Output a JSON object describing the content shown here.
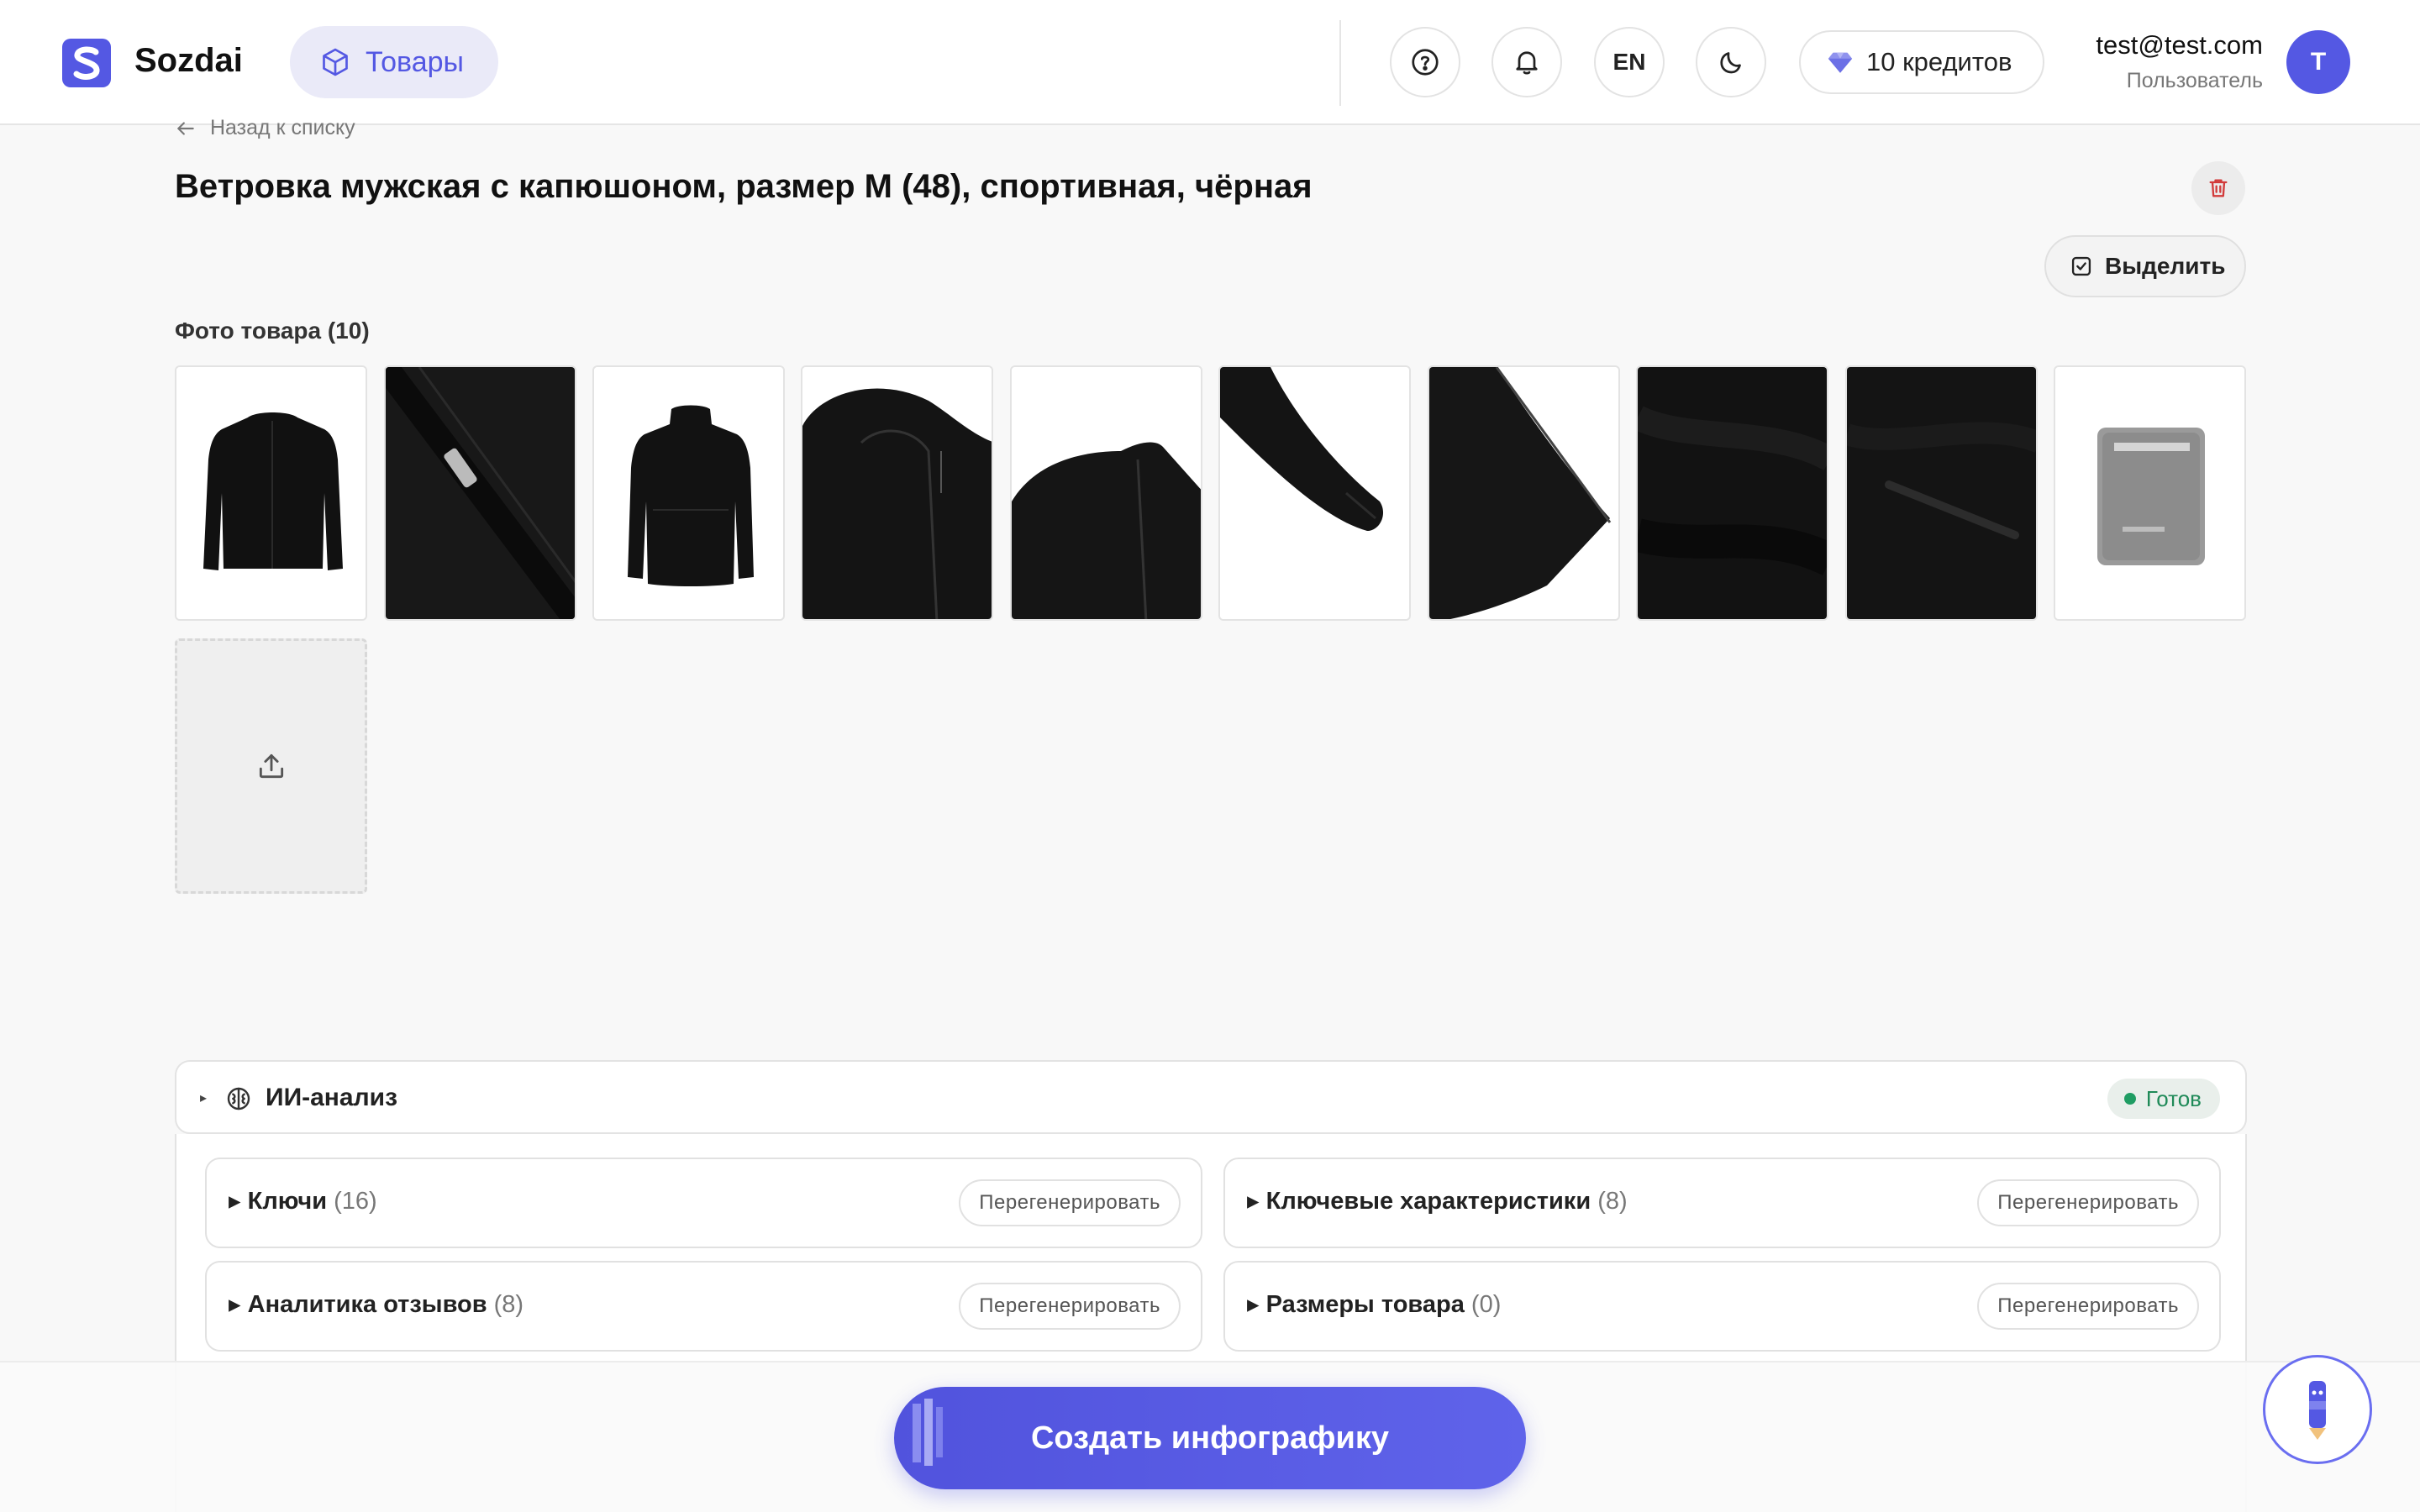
{
  "header": {
    "brand": "Sozdai",
    "nav_item": "Товары",
    "lang": "EN",
    "credits": "10 кредитов",
    "user_email": "test@test.com",
    "user_role": "Пользователь",
    "avatar_letter": "T"
  },
  "product": {
    "back_label": "Назад к списку",
    "title": "Ветровка мужская с капюшоном, размер M (48), спортивная, чёрная",
    "select_label": "Выделить",
    "photos_title": "Фото товара (10)"
  },
  "ai": {
    "title": "ИИ-анализ",
    "status": "Готов",
    "status_color": "#1f9d63",
    "regen_label": "Перегенерировать",
    "sections": [
      {
        "title": "Ключи",
        "count": "(16)"
      },
      {
        "title": "Ключевые характеристики",
        "count": "(8)"
      },
      {
        "title": "Аналитика отзывов",
        "count": "(8)"
      },
      {
        "title": "Размеры товара",
        "count": "(0)"
      }
    ]
  },
  "cta": {
    "label": "Создать инфографику",
    "accent": "#5458e3"
  }
}
